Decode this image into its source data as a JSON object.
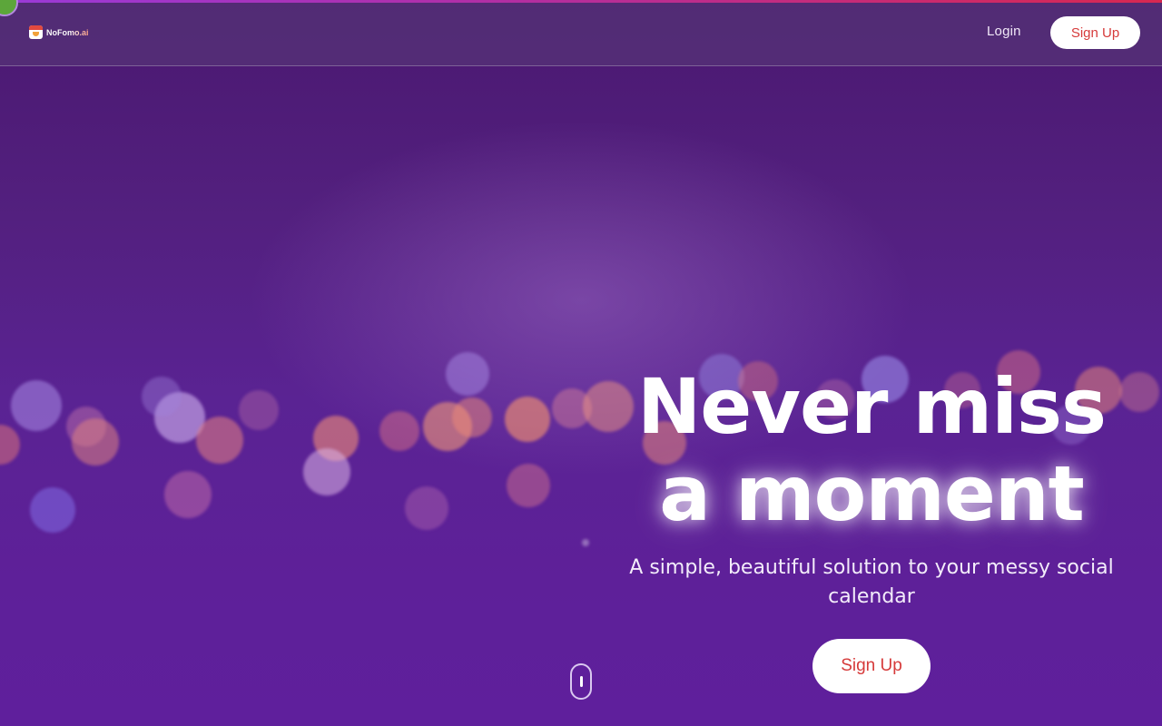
{
  "brand": {
    "name": "NoFomo.ai",
    "logo_icon": "calendar-face-icon"
  },
  "header": {
    "login_label": "Login",
    "signup_label": "Sign Up"
  },
  "hero": {
    "headline_line1": "Never miss",
    "headline_line2": "a moment",
    "subtitle": "A simple, beautiful solution to your messy social calendar",
    "cta_label": "Sign Up"
  },
  "scroll_indicator": {
    "icon": "mouse-scroll-icon"
  },
  "colors": {
    "background": "#5a2393",
    "accent_text": "#d63a3a",
    "button_bg": "#ffffff",
    "progress_bar_start": "#9a3ad8",
    "progress_bar_end": "#d82850"
  }
}
